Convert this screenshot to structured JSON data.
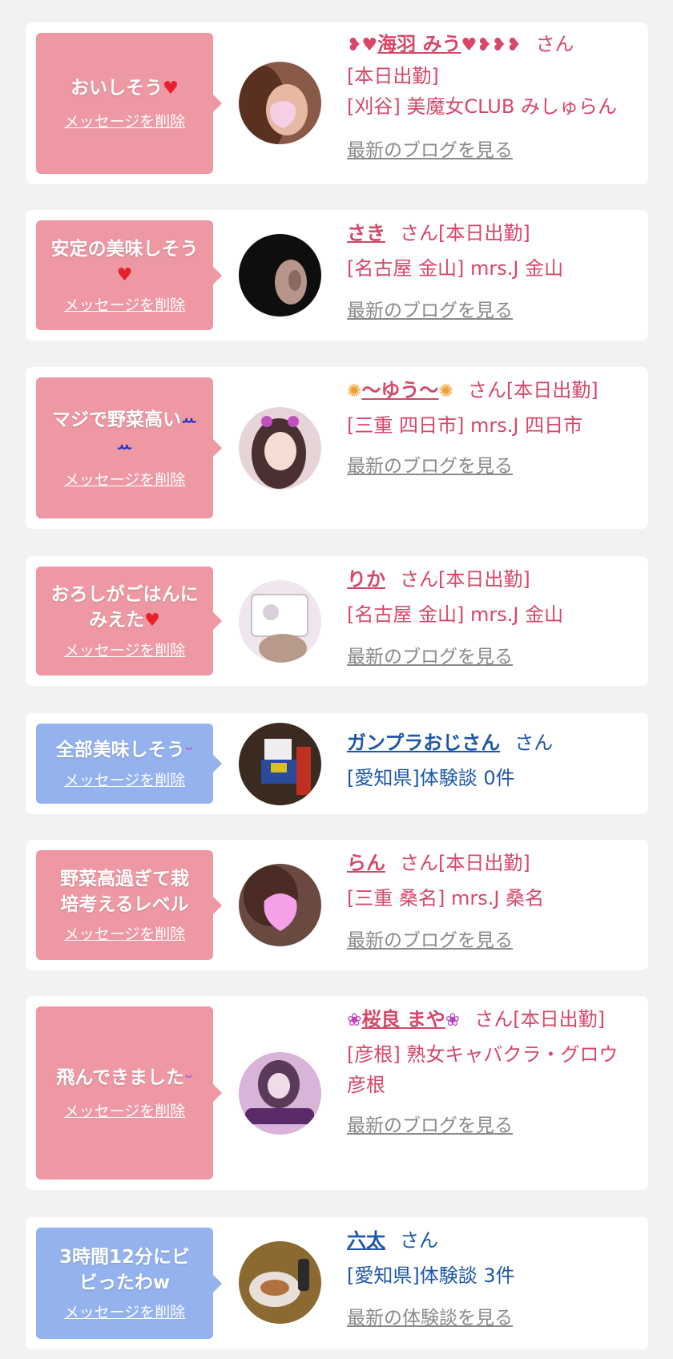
{
  "delete_label": "メッセージを削除",
  "san_label": "さん",
  "colors": {
    "pink_bubble": "#ee98a3",
    "blue_bubble": "#94b2ee",
    "pink_text": "#d84668",
    "blue_text": "#1d57a8",
    "link_gray": "#8a8a8a"
  },
  "messages": [
    {
      "text": "おいしそう",
      "emoji": "heart-icon",
      "name": "海羽 みう",
      "name_prefix": "❥♥",
      "name_suffix": "♥❥❥❥",
      "status": "[本日出勤]",
      "shop": "[刈谷] 美魔女CLUB みしゅらん",
      "link": "最新のブログを見る"
    },
    {
      "text": "安定の美味しそう",
      "emoji": "heart-icon",
      "name": "さき",
      "status": "[本日出勤]",
      "shop": "[名古屋 金山] mrs.J 金山",
      "link": "最新のブログを見る"
    },
    {
      "text": "マジで野菜高い",
      "emoji": "tears-icon",
      "name": "〜ゆう〜",
      "name_prefix": "✺",
      "name_suffix": "✺",
      "status": "[本日出勤]",
      "shop": "[三重 四日市] mrs.J 四日市",
      "link": "最新のブログを見る"
    },
    {
      "text": "おろしがごはんにみえた",
      "emoji": "hearts-icon",
      "name": "りか",
      "status": "[本日出勤]",
      "shop": "[名古屋 金山] mrs.J 金山",
      "link": "最新のブログを見る"
    },
    {
      "text": "全部美味しそう",
      "emoji": "smile-icon",
      "name": "ガンプラおじさん",
      "shop": "[愛知県]体験談 0件"
    },
    {
      "text": "野菜高過ぎて栽培考えるレベル",
      "name": "らん",
      "status": "[本日出勤]",
      "shop": "[三重 桑名] mrs.J 桑名",
      "link": "最新のブログを見る"
    },
    {
      "text": "飛んできました",
      "emoji": "smile-icon",
      "name": "桜良 まや",
      "name_prefix": "❀",
      "name_suffix": "❀",
      "status": "[本日出勤]",
      "shop": "[彦根] 熟女キャバクラ・グロウ彦根",
      "link": "最新のブログを見る"
    },
    {
      "text": "3時間12分にビビったわw",
      "name": "六太",
      "shop": "[愛知県]体験談 3件",
      "link": "最新の体験談を見る"
    }
  ]
}
